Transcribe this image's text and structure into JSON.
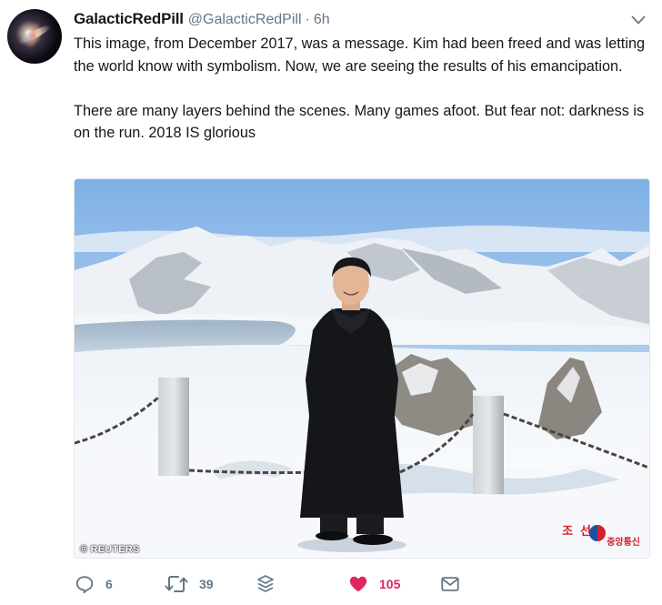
{
  "tweet": {
    "author_name": "GalacticRedPill",
    "author_handle": "@GalacticRedPill",
    "separator": "·",
    "timestamp": "6h",
    "paragraphs": [
      "This image, from December 2017, was a message. Kim had been freed and was letting the world know with symbolism. Now, we are seeing the results of his emancipation.",
      "There are many layers behind the scenes. Many games afoot. But fear not: darkness is on the run. 2018 IS glorious"
    ],
    "media": {
      "credit": "© REUTERS",
      "agency_title": "조선",
      "agency_subtitle": "중앙통신"
    },
    "actions": {
      "reply_count": "6",
      "retweet_count": "39",
      "like_count": "105",
      "liked": true
    },
    "icons": {
      "more": "chevron-down-icon",
      "reply": "reply-icon",
      "retweet": "retweet-icon",
      "stack": "stack-layers-icon",
      "like": "heart-icon",
      "message": "envelope-icon"
    },
    "colors": {
      "text": "#14171a",
      "muted": "#657786",
      "like": "#e0245e"
    }
  }
}
